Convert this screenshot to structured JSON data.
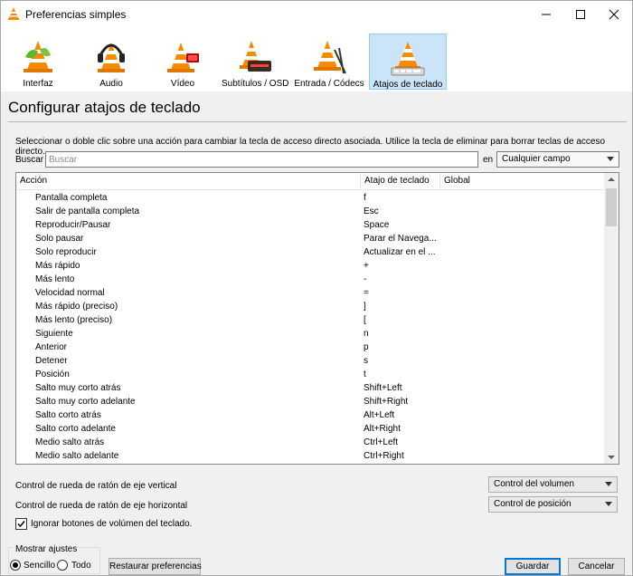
{
  "window": {
    "title": "Preferencias simples",
    "accent_color": "#0078d7"
  },
  "categories": [
    {
      "label": "Interfaz",
      "icon": "vlc-cone-interface-icon"
    },
    {
      "label": "Audio",
      "icon": "vlc-cone-headphones-icon"
    },
    {
      "label": "Vídeo",
      "icon": "vlc-cone-video-icon"
    },
    {
      "label": "Subtítulos / OSD",
      "icon": "vlc-cone-subtitles-icon"
    },
    {
      "label": "Entrada / Códecs",
      "icon": "vlc-cone-input-icon"
    },
    {
      "label": "Atajos de teclado",
      "icon": "vlc-cone-hotkeys-icon",
      "selected": true
    }
  ],
  "page": {
    "title": "Configurar atajos de teclado",
    "instructions": "Seleccionar o doble clic sobre una acción para cambiar la tecla de acceso directo asociada. Utilice la tecla de eliminar para borrar teclas de acceso directo."
  },
  "search": {
    "label": "Buscar",
    "placeholder": "Buscar",
    "value": "",
    "in_label": "en",
    "field": "Cualquier campo"
  },
  "table": {
    "columns": [
      "Acción",
      "Atajo de teclado",
      "Global"
    ],
    "rows": [
      {
        "action": "Pantalla completa",
        "hotkey": "f"
      },
      {
        "action": "Salir de pantalla completa",
        "hotkey": "Esc"
      },
      {
        "action": "Reproducir/Pausar",
        "hotkey": "Space"
      },
      {
        "action": "Solo pausar",
        "hotkey": "Parar el Navega..."
      },
      {
        "action": "Solo reproducir",
        "hotkey": "Actualizar en el ..."
      },
      {
        "action": "Más rápido",
        "hotkey": "+"
      },
      {
        "action": "Más lento",
        "hotkey": "-"
      },
      {
        "action": "Velocidad normal",
        "hotkey": "="
      },
      {
        "action": "Más rápido (preciso)",
        "hotkey": "]"
      },
      {
        "action": "Más lento (preciso)",
        "hotkey": "["
      },
      {
        "action": "Siguiente",
        "hotkey": "n"
      },
      {
        "action": "Anterior",
        "hotkey": "p"
      },
      {
        "action": "Detener",
        "hotkey": "s"
      },
      {
        "action": "Posición",
        "hotkey": "t"
      },
      {
        "action": "Salto muy corto atrás",
        "hotkey": "Shift+Left"
      },
      {
        "action": "Salto muy corto adelante",
        "hotkey": "Shift+Right"
      },
      {
        "action": "Salto corto atrás",
        "hotkey": "Alt+Left"
      },
      {
        "action": "Salto corto adelante",
        "hotkey": "Alt+Right"
      },
      {
        "action": "Medio salto atrás",
        "hotkey": "Ctrl+Left"
      },
      {
        "action": "Medio salto adelante",
        "hotkey": "Ctrl+Right"
      }
    ]
  },
  "options": {
    "vertical_wheel_label": "Control de rueda de ratón de eje vertical",
    "vertical_wheel_value": "Control del volumen",
    "horizontal_wheel_label": "Control de rueda de ratón de eje horizontal",
    "horizontal_wheel_value": "Control de posición",
    "ignore_volume_keys_label": "Ignorar botones de volúmen del teclado.",
    "ignore_volume_keys_checked": true
  },
  "footer": {
    "show_settings_title": "Mostrar ajustes",
    "simple_label": "Sencillo",
    "all_label": "Todo",
    "selected": "Sencillo",
    "reset_label": "Restaurar preferencias",
    "save_label": "Guardar",
    "cancel_label": "Cancelar"
  }
}
